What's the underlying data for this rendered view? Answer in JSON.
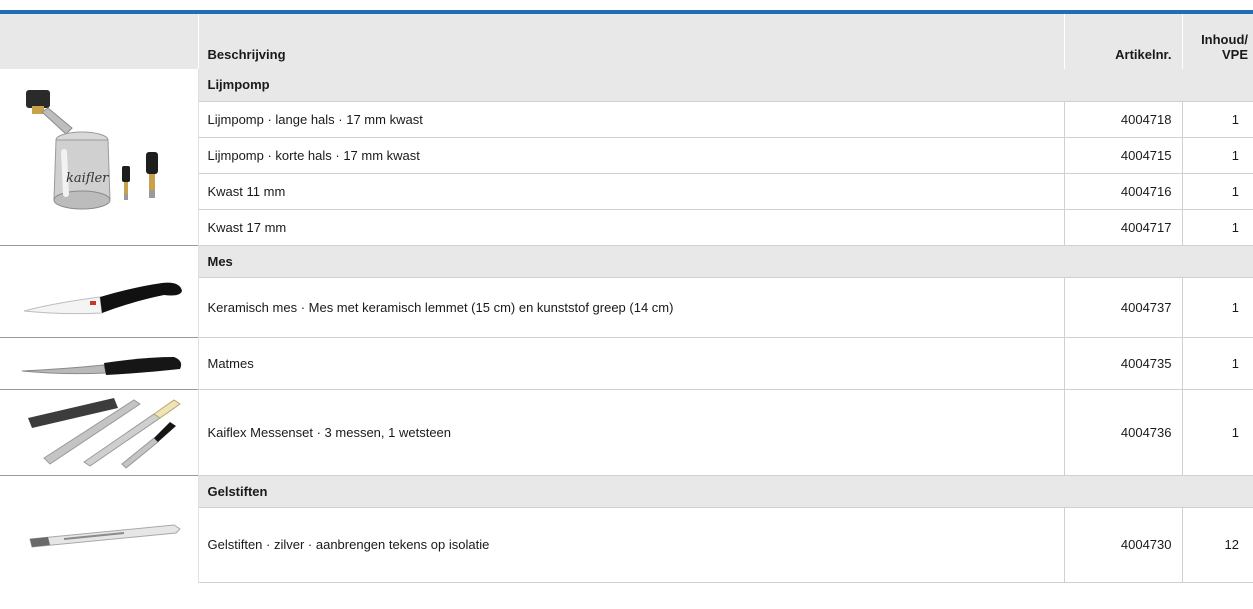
{
  "header": {
    "description": "Beschrijving",
    "article_no": "Artikelnr.",
    "contents_line1": "Inhoud/",
    "contents_line2": "VPE"
  },
  "groups": {
    "glue_pump": {
      "title": "Lijmpomp",
      "image_label": "kaifler",
      "items": [
        {
          "description": "Lijmpomp · lange hals · 17 mm kwast",
          "article": "4004718",
          "qty": "1"
        },
        {
          "description": "Lijmpomp · korte hals · 17 mm kwast",
          "article": "4004715",
          "qty": "1"
        },
        {
          "description": "Kwast 11 mm",
          "article": "4004716",
          "qty": "1"
        },
        {
          "description": "Kwast 17 mm",
          "article": "4004717",
          "qty": "1"
        }
      ]
    },
    "knife": {
      "title": "Mes",
      "items": [
        {
          "description": "Keramisch mes · Mes met keramisch lemmet (15 cm) en kunststof greep (14 cm)",
          "article": "4004737",
          "qty": "1"
        },
        {
          "description": "Matmes",
          "article": "4004735",
          "qty": "1"
        },
        {
          "description": "Kaiflex Messenset · 3 messen, 1 wetsteen",
          "article": "4004736",
          "qty": "1"
        }
      ]
    },
    "gel_pens": {
      "title": "Gelstiften",
      "items": [
        {
          "description": "Gelstiften · zilver · aanbrengen tekens op isolatie",
          "article": "4004730",
          "qty": "12"
        }
      ]
    }
  },
  "colors": {
    "accent": "#1f6fb2",
    "header_bg": "#e8e8e8"
  }
}
